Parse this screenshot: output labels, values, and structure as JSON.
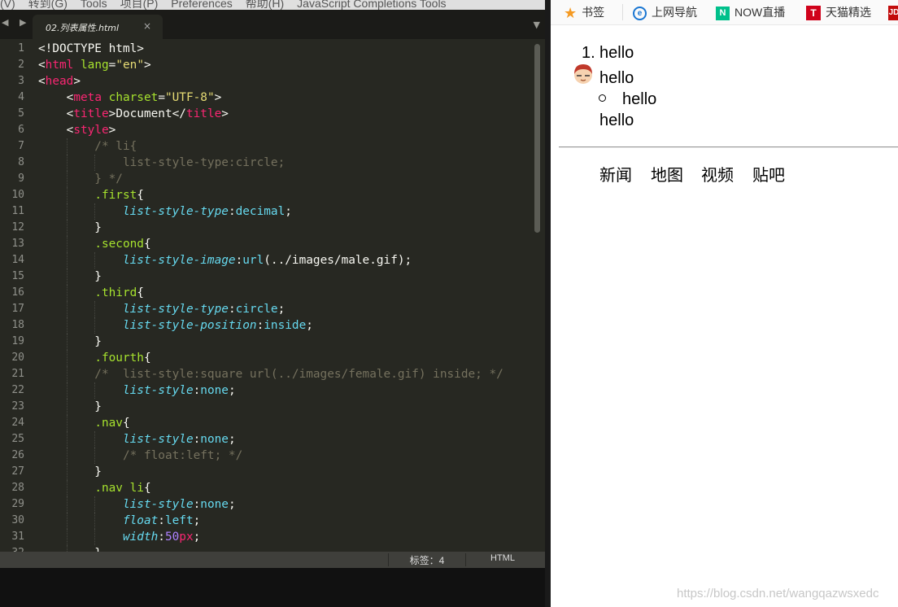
{
  "editor": {
    "menu": [
      "(V)",
      "转到(G)",
      "Tools",
      "项目(P)",
      "Preferences",
      "帮助(H)",
      "JavaScript Completions Tools"
    ],
    "nav_arrows": "◀ ▶",
    "tab_dropdown": "▼",
    "tab": {
      "title": "02.列表属性.html",
      "close": "×"
    },
    "lines": [
      [
        [
          "t-pun",
          "<!DOCTYPE html>"
        ]
      ],
      [
        [
          "t-pun",
          "<"
        ],
        [
          "t-tag",
          "html"
        ],
        [
          "t-pun",
          " "
        ],
        [
          "t-attr",
          "lang"
        ],
        [
          "t-pun",
          "="
        ],
        [
          "t-str",
          "\"en\""
        ],
        [
          "t-pun",
          ">"
        ]
      ],
      [
        [
          "t-pun",
          "<"
        ],
        [
          "t-tag",
          "head"
        ],
        [
          "t-pun",
          ">"
        ]
      ],
      [
        [
          "t-pun",
          "    <"
        ],
        [
          "t-tag",
          "meta"
        ],
        [
          "t-pun",
          " "
        ],
        [
          "t-attr",
          "charset"
        ],
        [
          "t-pun",
          "="
        ],
        [
          "t-str",
          "\"UTF-8\""
        ],
        [
          "t-pun",
          ">"
        ]
      ],
      [
        [
          "t-pun",
          "    <"
        ],
        [
          "t-tag",
          "title"
        ],
        [
          "t-pun",
          ">Document</"
        ],
        [
          "t-tag",
          "title"
        ],
        [
          "t-pun",
          ">"
        ]
      ],
      [
        [
          "t-pun",
          "    <"
        ],
        [
          "t-tag",
          "style"
        ],
        [
          "t-pun",
          ">"
        ]
      ],
      [
        [
          "t-com",
          "        /* li{"
        ]
      ],
      [
        [
          "t-com",
          "            list-style-type:circle;"
        ]
      ],
      [
        [
          "t-com",
          "        } */"
        ]
      ],
      [
        [
          "t-pun",
          "        "
        ],
        [
          "t-sel",
          ".first"
        ],
        [
          "t-pun",
          "{"
        ]
      ],
      [
        [
          "t-pun",
          "            "
        ],
        [
          "t-prop",
          "list-style-type"
        ],
        [
          "t-pun",
          ":"
        ],
        [
          "t-val",
          "decimal"
        ],
        [
          "t-pun",
          ";"
        ]
      ],
      [
        [
          "t-pun",
          "        }"
        ]
      ],
      [
        [
          "t-pun",
          "        "
        ],
        [
          "t-sel",
          ".second"
        ],
        [
          "t-pun",
          "{"
        ]
      ],
      [
        [
          "t-pun",
          "            "
        ],
        [
          "t-prop",
          "list-style-image"
        ],
        [
          "t-pun",
          ":"
        ],
        [
          "t-val",
          "url"
        ],
        [
          "t-pun",
          "(../images/male.gif);"
        ]
      ],
      [
        [
          "t-pun",
          "        }"
        ]
      ],
      [
        [
          "t-pun",
          "        "
        ],
        [
          "t-sel",
          ".third"
        ],
        [
          "t-pun",
          "{"
        ]
      ],
      [
        [
          "t-pun",
          "            "
        ],
        [
          "t-prop",
          "list-style-type"
        ],
        [
          "t-pun",
          ":"
        ],
        [
          "t-val",
          "circle"
        ],
        [
          "t-pun",
          ";"
        ]
      ],
      [
        [
          "t-pun",
          "            "
        ],
        [
          "t-prop",
          "list-style-position"
        ],
        [
          "t-pun",
          ":"
        ],
        [
          "t-val",
          "inside"
        ],
        [
          "t-pun",
          ";"
        ]
      ],
      [
        [
          "t-pun",
          "        }"
        ]
      ],
      [
        [
          "t-pun",
          "        "
        ],
        [
          "t-sel",
          ".fourth"
        ],
        [
          "t-pun",
          "{"
        ]
      ],
      [
        [
          "t-com",
          "        /*  list-style:square url(../images/female.gif) inside; */"
        ]
      ],
      [
        [
          "t-pun",
          "            "
        ],
        [
          "t-prop",
          "list-style"
        ],
        [
          "t-pun",
          ":"
        ],
        [
          "t-val",
          "none"
        ],
        [
          "t-pun",
          ";"
        ]
      ],
      [
        [
          "t-pun",
          "        }"
        ]
      ],
      [
        [
          "t-pun",
          "        "
        ],
        [
          "t-sel",
          ".nav"
        ],
        [
          "t-pun",
          "{"
        ]
      ],
      [
        [
          "t-pun",
          "            "
        ],
        [
          "t-prop",
          "list-style"
        ],
        [
          "t-pun",
          ":"
        ],
        [
          "t-val",
          "none"
        ],
        [
          "t-pun",
          ";"
        ]
      ],
      [
        [
          "t-com",
          "            /* float:left; */"
        ]
      ],
      [
        [
          "t-pun",
          "        }"
        ]
      ],
      [
        [
          "t-pun",
          "        "
        ],
        [
          "t-sel",
          ".nav li"
        ],
        [
          "t-pun",
          "{"
        ]
      ],
      [
        [
          "t-pun",
          "            "
        ],
        [
          "t-prop",
          "list-style"
        ],
        [
          "t-pun",
          ":"
        ],
        [
          "t-val",
          "none"
        ],
        [
          "t-pun",
          ";"
        ]
      ],
      [
        [
          "t-pun",
          "            "
        ],
        [
          "t-prop",
          "float"
        ],
        [
          "t-pun",
          ":"
        ],
        [
          "t-val",
          "left"
        ],
        [
          "t-pun",
          ";"
        ]
      ],
      [
        [
          "t-pun",
          "            "
        ],
        [
          "t-prop",
          "width"
        ],
        [
          "t-pun",
          ":"
        ],
        [
          "t-num",
          "50"
        ],
        [
          "t-unit",
          "px"
        ],
        [
          "t-pun",
          ";"
        ]
      ],
      [
        [
          "t-pun",
          "        }"
        ]
      ]
    ],
    "status": {
      "tab_size": "标签：4",
      "syntax": "HTML"
    }
  },
  "browser": {
    "bookmarks": [
      "书签",
      "上网导航",
      "NOW直播",
      "天猫精选"
    ],
    "bookmark_icons": {
      "now": "N",
      "tmall": "T",
      "jd": "JD",
      "ie": "e"
    },
    "list": {
      "first_marker": "1.",
      "first": "hello",
      "second": "hello",
      "third": "hello",
      "fourth": "hello"
    },
    "nav": [
      "新闻",
      "地图",
      "视频",
      "贴吧"
    ],
    "watermark": "https://blog.csdn.net/wangqazwsxedc"
  }
}
